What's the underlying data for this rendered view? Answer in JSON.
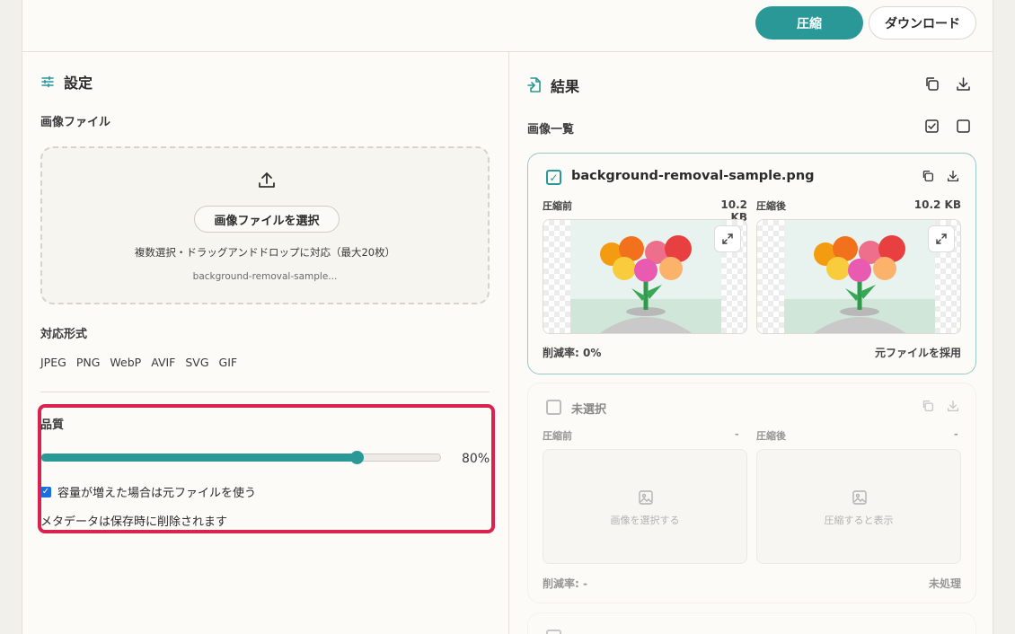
{
  "toolbar": {
    "compress_label": "圧縮",
    "download_label": "ダウンロード"
  },
  "settings": {
    "title": "設定",
    "image_file_label": "画像ファイル",
    "select_button": "画像ファイルを選択",
    "dropzone_hint": "複数選択・ドラッグアンドドロップに対応（最大20枚）",
    "selected_file": "background-removal-sample...",
    "formats_label": "対応形式",
    "formats": [
      "JPEG",
      "PNG",
      "WebP",
      "AVIF",
      "SVG",
      "GIF"
    ],
    "quality_label": "品質",
    "quality_value": 80,
    "quality_display": "80%",
    "use_original_checked": true,
    "use_original_label": "容量が増えた場合は元ファイルを使う",
    "metadata_note": "メタデータは保存時に削除されます"
  },
  "results": {
    "title": "結果",
    "list_label": "画像一覧",
    "cards": [
      {
        "selected": true,
        "filename": "background-removal-sample.png",
        "before_label": "圧縮前",
        "before_size": "10.2 KB",
        "after_label": "圧縮後",
        "after_size": "10.2 KB",
        "reduction": "削減率: 0%",
        "status": "元ファイルを採用"
      },
      {
        "selected": false,
        "filename": "未選択",
        "before_label": "圧縮前",
        "before_size": "-",
        "after_label": "圧縮後",
        "after_size": "-",
        "before_placeholder": "画像を選択する",
        "after_placeholder": "圧縮すると表示",
        "reduction": "削減率: -",
        "status": "未処理"
      }
    ]
  },
  "colors": {
    "accent": "#2a9896",
    "highlight": "#d9234e",
    "checkbox": "#1a6fe0"
  }
}
